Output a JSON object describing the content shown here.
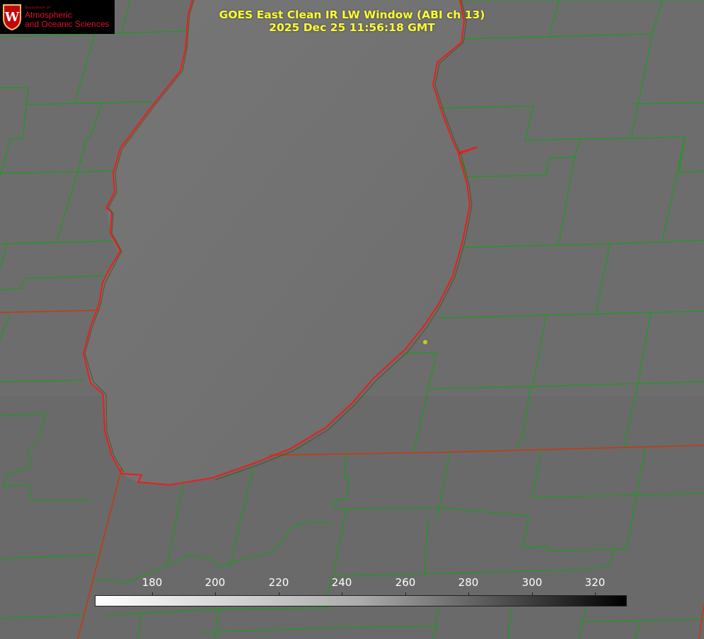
{
  "title": {
    "line1": "GOES East Clean IR LW Window (ABI ch 13)",
    "line2": "2025 Dec 25 11:56:18 GMT"
  },
  "logo": {
    "dept": "Department of",
    "line1": "Atmospheric",
    "line2": "and Oceanic Sciences",
    "crest_letter": "W"
  },
  "colorbar": {
    "ticks": [
      "180",
      "200",
      "220",
      "240",
      "260",
      "280",
      "300",
      "320"
    ],
    "colors": {
      "low": "#ffffff",
      "high": "#000000"
    }
  },
  "colors": {
    "county_lines": "#1f9a1f",
    "state_lines": "#c43a12",
    "coastline": "#ee1c1c",
    "marker": "#d8c020",
    "title": "#ffff33"
  }
}
